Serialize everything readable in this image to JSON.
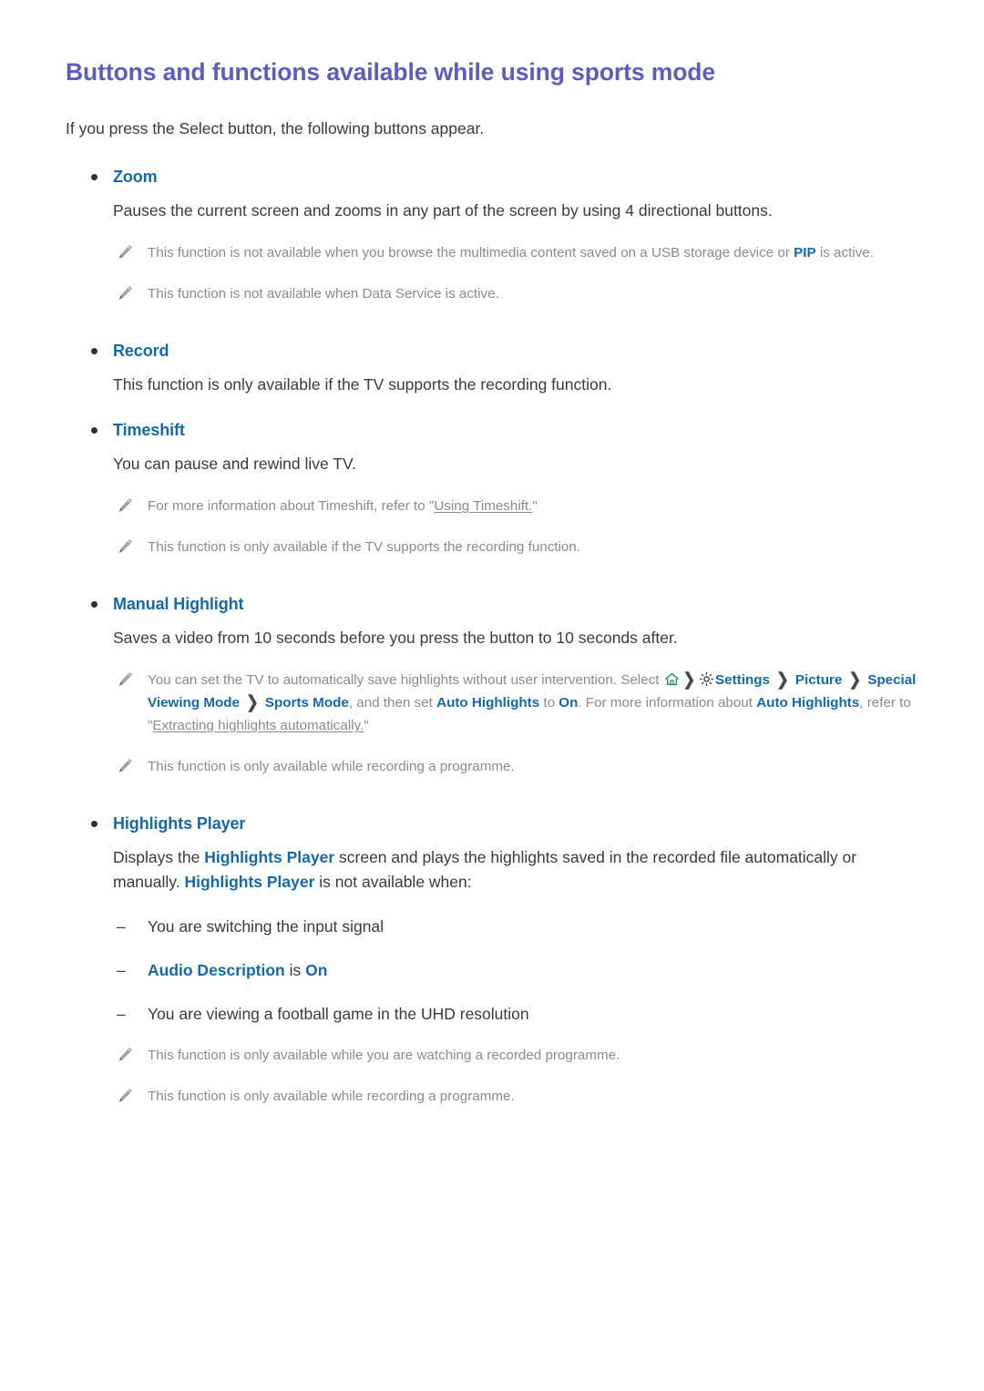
{
  "document": {
    "title": "Buttons and functions available while using sports mode",
    "intro": "If you press the Select button, the following buttons appear.",
    "colors": {
      "title": "#5d5dbe",
      "link": "#1668a8",
      "body_text": "#3a3a3a",
      "note_text": "#8a8a8a",
      "home_icon": "#2e8b72",
      "gear_icon": "#3a3a3a"
    }
  },
  "sections": {
    "zoom": {
      "label": "Zoom",
      "description": "Pauses the current screen and zooms in any part of the screen by using 4 directional buttons.",
      "notes": {
        "note1_a": "This function is not available when you browse the multimedia content saved on a USB storage device or ",
        "note1_kw": "PIP",
        "note1_b": " is active.",
        "note2": "This function is not available when Data Service is active."
      }
    },
    "record": {
      "label": "Record",
      "description": "This function is only available if the TV supports the recording function."
    },
    "timeshift": {
      "label": "Timeshift",
      "description": "You can pause and rewind live TV.",
      "notes": {
        "note1_a": "For more information about Timeshift, refer to \"",
        "note1_xref": "Using Timeshift.",
        "note1_b": "\"",
        "note2": "This function is only available if the TV supports the recording function."
      }
    },
    "manual_highlight": {
      "label": "Manual Highlight",
      "description": "Saves a video from 10 seconds before you press the button to 10 seconds after.",
      "notes": {
        "path_note": {
          "lead": "You can set the TV to automatically save highlights without user intervention. Select ",
          "home_icon": "home-icon",
          "chevron": "❯",
          "gear_icon": "gear-icon",
          "settings": "Settings",
          "picture": "Picture",
          "special_viewing_mode": "Special Viewing Mode",
          "sports_mode": "Sports Mode",
          "mid": ", and then set ",
          "auto_highlights": "Auto Highlights",
          "to": " to ",
          "on": "On",
          "tail": ". For more information about ",
          "auto_highlights_2": "Auto Highlights",
          "refer": ", refer to \"",
          "xref": "Extracting highlights automatically.",
          "close_quote": "\""
        },
        "note2": "This function is only available while recording a programme."
      }
    },
    "highlights_player": {
      "label": "Highlights Player",
      "description": {
        "part1": "Displays the ",
        "kw1": "Highlights Player",
        "part2": " screen and plays the highlights saved in the recorded file automatically or manually. ",
        "kw2": "Highlights Player",
        "part3": " is not available when:"
      },
      "dash_items": [
        {
          "text": "You are switching the input signal"
        },
        {
          "kw": "Audio Description",
          "mid": " is ",
          "kw2": "On"
        },
        {
          "text": "You are viewing a football game in the UHD resolution"
        }
      ],
      "notes": {
        "note1": "This function is only available while you are watching a recorded programme.",
        "note2": "This function is only available while recording a programme."
      }
    }
  }
}
